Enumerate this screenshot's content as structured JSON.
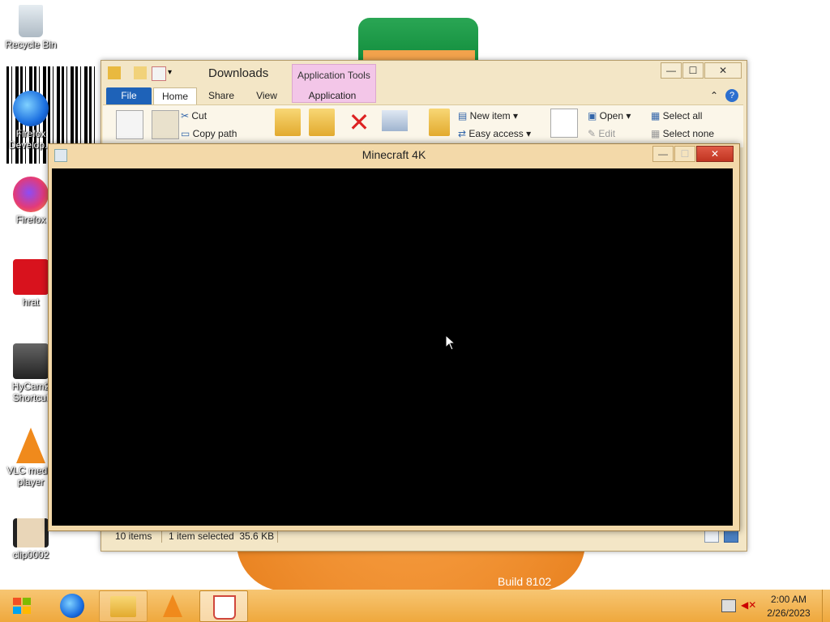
{
  "desktop": {
    "build_text": "Build 8102",
    "icons": [
      {
        "label": "Recycle Bin"
      },
      {
        "label": "Firefox\nDevelop..."
      },
      {
        "label": "Firefox"
      },
      {
        "label": "hrat"
      },
      {
        "label": "HyCam2\nShortcut"
      },
      {
        "label": "VLC media\nplayer"
      },
      {
        "label": "clip0002"
      }
    ]
  },
  "explorer": {
    "title": "Downloads",
    "contextual_tab_group": "Application Tools",
    "tabs": {
      "file": "File",
      "home": "Home",
      "share": "Share",
      "view": "View",
      "application": "Application"
    },
    "ribbon": {
      "cut": "Cut",
      "copy_path": "Copy path",
      "new_item": "New item",
      "easy_access": "Easy access",
      "open": "Open",
      "edit": "Edit",
      "select_all": "Select all",
      "select_none": "Select none"
    },
    "window_buttons": {
      "minimize": "—",
      "maximize": "☐",
      "close": "✕"
    },
    "status": {
      "items": "10 items",
      "selected": "1 item selected  35.6 KB"
    }
  },
  "minecraft": {
    "title": "Minecraft 4K",
    "window_buttons": {
      "minimize": "—",
      "maximize": "☐",
      "close": "✕"
    }
  },
  "taskbar": {
    "time": "2:00 AM",
    "date": "2/26/2023"
  },
  "colors": {
    "taskbar": "#efa83d",
    "file_tab": "#1e62b8",
    "context_tab": "#f3c6e8",
    "close_button": "#c03421"
  }
}
